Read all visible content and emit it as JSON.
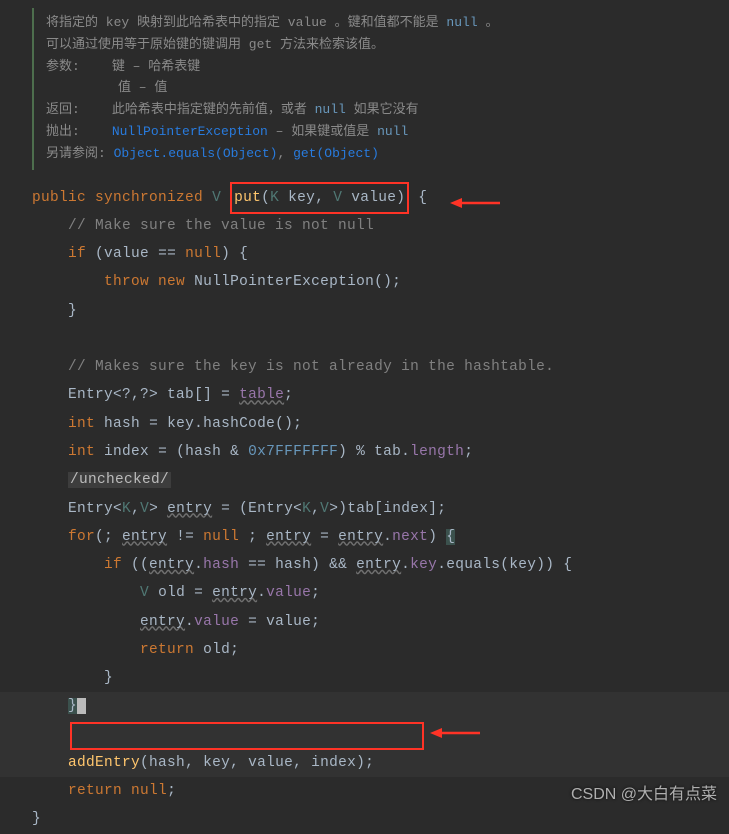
{
  "doc": {
    "line1_a": "将指定的 key 映射到此哈希表中的指定 value 。键和值都不能是 ",
    "line1_null": "null",
    "line1_b": " 。",
    "line2": "可以通过使用等于原始键的键调用 get 方法来检索该值。",
    "params_label": "参数:",
    "param_key": "键 – 哈希表键",
    "param_val": "值 – 值",
    "returns_label": "返回:",
    "returns_text_a": "此哈希表中指定键的先前值，或者 ",
    "returns_null": "null",
    "returns_text_b": " 如果它没有",
    "throws_label": "抛出:",
    "throws_link": "NullPointerException",
    "throws_text": " – 如果键或值是 ",
    "throws_null": "null",
    "see_label": "另请参阅:",
    "see_link1": "Object.equals(Object)",
    "see_sep": ", ",
    "see_link2": "get(Object)"
  },
  "code": {
    "l1_public": "public",
    "l1_sync": "synchronized",
    "l1_v": "V",
    "l1_put": "put",
    "l1_k": "K",
    "l1_key": "key",
    "l1_v2": "V",
    "l1_value": "value",
    "l2_cmt": "// Make sure the value is not null",
    "l3_if": "if",
    "l3_val": "value",
    "l3_null": "null",
    "l4_throw": "throw",
    "l4_new": "new",
    "l4_ex": "NullPointerException",
    "l6_cmt": "// Makes sure the key is not already in the hashtable.",
    "l7_entry": "Entry",
    "l7_tab": "tab",
    "l7_table": "table",
    "l8_int": "int",
    "l8_hash": "hash",
    "l8_key": "key",
    "l8_hc": "hashCode",
    "l9_int": "int",
    "l9_index": "index",
    "l9_hash": "hash",
    "l9_hex": "0x7FFFFFFF",
    "l9_tab": "tab",
    "l9_len": "length",
    "l10_unchecked": "/unchecked/",
    "l11_entry": "Entry",
    "l11_k": "K",
    "l11_v": "V",
    "l11_e": "entry",
    "l11_tab": "tab",
    "l11_idx": "index",
    "l12_for": "for",
    "l12_e": "entry",
    "l12_null": "null",
    "l12_e2": "entry",
    "l12_e3": "entry",
    "l12_next": "next",
    "l13_if": "if",
    "l13_e": "entry",
    "l13_hash": "hash",
    "l13_h2": "hash",
    "l13_e2": "entry",
    "l13_key": "key",
    "l13_eq": "equals",
    "l13_k2": "key",
    "l14_v": "V",
    "l14_old": "old",
    "l14_e": "entry",
    "l14_val": "value",
    "l15_e": "entry",
    "l15_val": "value",
    "l15_v2": "value",
    "l16_ret": "return",
    "l16_old": "old",
    "l18_add": "addEntry",
    "l18_hash": "hash",
    "l18_key": "key",
    "l18_value": "value",
    "l18_idx": "index",
    "l19_ret": "return",
    "l19_null": "null"
  },
  "watermark": "CSDN @大白有点菜"
}
